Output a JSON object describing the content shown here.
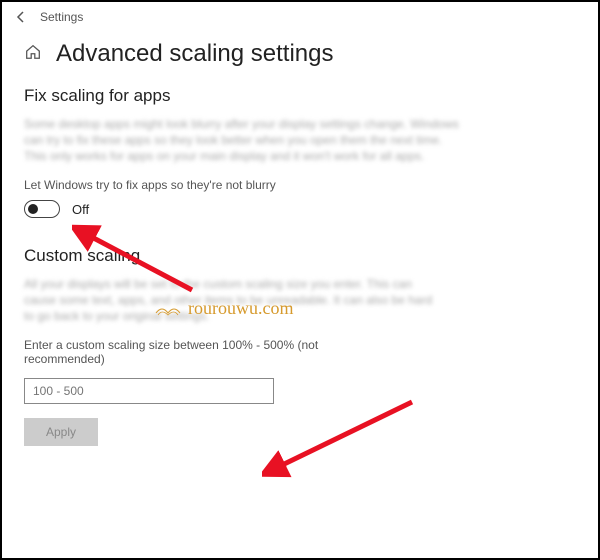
{
  "header": {
    "settings_label": "Settings"
  },
  "page": {
    "title": "Advanced scaling settings",
    "section1": "Fix scaling for apps",
    "blurred1": "Some desktop apps might look blurry after your display settings change. Windows can try to fix these apps so they look better when you open them the next time. This only works for apps on your main display and it won't work for all apps.",
    "toggle_caption": "Let Windows try to fix apps so they're not blurry",
    "toggle_value": "Off",
    "section2": "Custom scaling",
    "blurred2": "All your displays will be set to the custom scaling size you enter. This can cause some text, apps, and other items to be unreadable. It can also be hard to go back to your original settings.",
    "input_label": "Enter a custom scaling size between 100% - 500% (not recommended)",
    "input_placeholder": "100 - 500",
    "apply_label": "Apply"
  },
  "watermark": {
    "text": "rourouwu.com"
  }
}
